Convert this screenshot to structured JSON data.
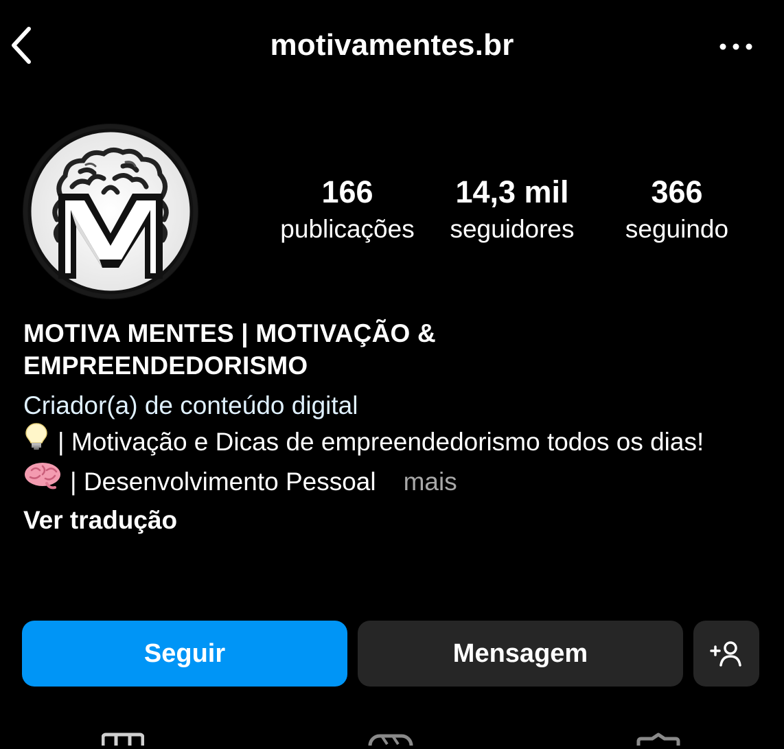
{
  "header": {
    "username": "motivamentes.br",
    "back_icon": "chevron-left-icon",
    "more_icon": "more-horizontal-icon"
  },
  "profile": {
    "avatar_icon": "brain-m-logo-icon",
    "avatar_logo_letter": "M"
  },
  "stats": [
    {
      "value": "166",
      "label": "publicações"
    },
    {
      "value": "14,3 mil",
      "label": "seguidores"
    },
    {
      "value": "366",
      "label": "seguindo"
    }
  ],
  "bio": {
    "name": "MOTIVA MENTES | MOTIVAÇÃO & EMPREENDEDORISMO",
    "category": "Criador(a) de conteúdo digital",
    "line1_emoji": "lightbulb-icon",
    "line1_text": "| Motivação e Dicas de empreendedorismo todos os dias!",
    "line2_emoji": "brain-icon",
    "line2_text": "| Desenvolvimento Pessoal",
    "more_label": "mais",
    "translate_label": "Ver tradução"
  },
  "actions": {
    "follow_label": "Seguir",
    "message_label": "Mensagem",
    "add_user_icon": "add-user-icon"
  },
  "tabs": [
    "grid-icon",
    "reels-icon",
    "tagged-icon"
  ],
  "colors": {
    "background": "#000000",
    "follow_button": "#0095f6",
    "secondary_button": "#262626",
    "category_text": "#e0f1ff",
    "muted_text": "#a8a8a8"
  }
}
